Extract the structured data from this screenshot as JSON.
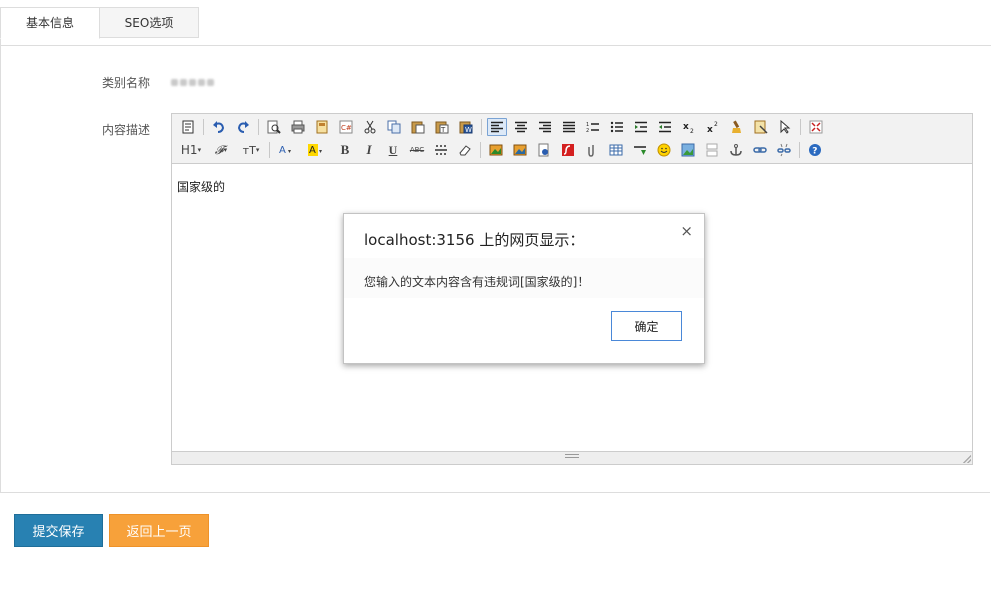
{
  "tabs": [
    {
      "label": "基本信息",
      "active": true
    },
    {
      "label": "SEO选项",
      "active": false
    }
  ],
  "form": {
    "category_label": "类别名称",
    "description_label": "内容描述"
  },
  "editor": {
    "toolbar_row1": [
      "source-icon",
      "undo-icon",
      "redo-icon",
      "preview-icon",
      "print-icon",
      "template-icon",
      "code-icon",
      "cut-icon",
      "copy-icon",
      "paste-icon",
      "paste-text-icon",
      "paste-word-icon",
      "align-left-icon",
      "align-center-icon",
      "align-right-icon",
      "justify-icon",
      "ordered-list-icon",
      "unordered-list-icon",
      "indent-icon",
      "outdent-icon",
      "subscript-icon",
      "superscript-icon",
      "clear-format-icon",
      "select-all-icon",
      "select-icon",
      "fullscreen-icon"
    ],
    "toolbar_row2": {
      "heading": "H1",
      "font_family": "𝓕",
      "font_size": "тT",
      "bold": "B",
      "italic": "I",
      "underline": "U",
      "strikethrough": "ABC"
    },
    "content": "国家级的"
  },
  "dialog": {
    "title": "localhost:3156 上的网页显示：",
    "message": "您输入的文本内容含有违规词[国家级的]！",
    "ok_label": "确定",
    "close_glyph": "×"
  },
  "actions": {
    "save_label": "提交保存",
    "back_label": "返回上一页"
  },
  "colors": {
    "save_button": "#2881b2",
    "back_button": "#f7a13a",
    "dialog_ok_border": "#4a88d8"
  }
}
